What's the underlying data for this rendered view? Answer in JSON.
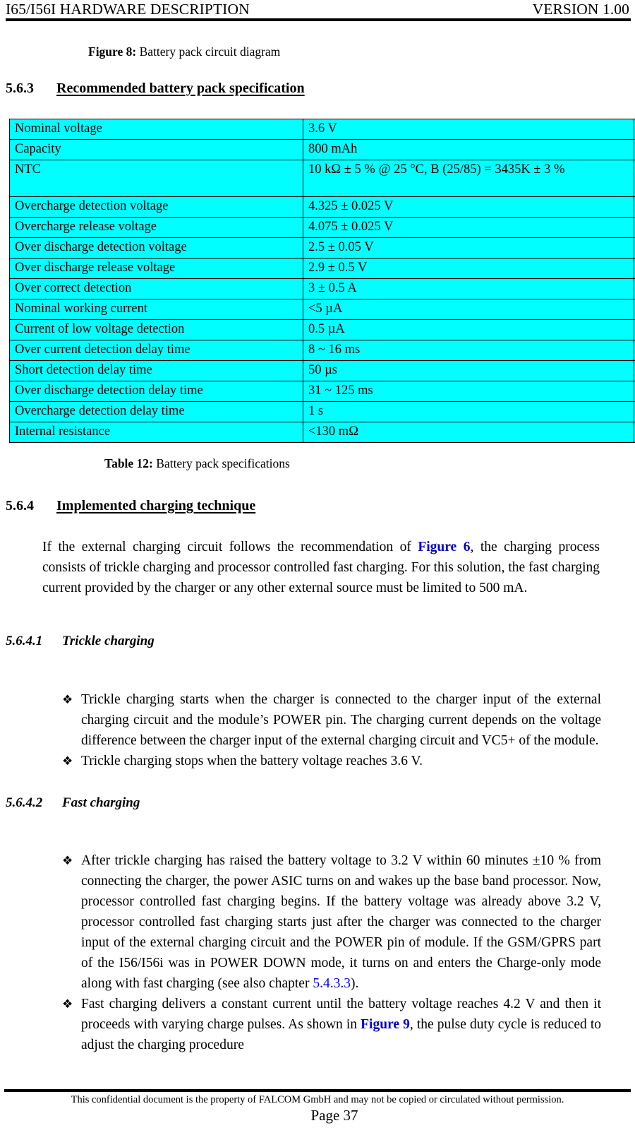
{
  "header": {
    "left": "I65/I56I HARDWARE DESCRIPTION",
    "right": "VERSION 1.00"
  },
  "figure_caption": {
    "label": "Figure 8:",
    "text": " Battery pack circuit diagram"
  },
  "section_563": {
    "number": "5.6.3",
    "title": "Recommended battery pack specification"
  },
  "spec_table": {
    "rows": [
      {
        "name": "Nominal voltage",
        "value": "3.6 V"
      },
      {
        "name": "Capacity",
        "value": "800 mAh"
      },
      {
        "name": "NTC",
        "value": "10 kΩ ± 5 % @ 25 °C, B (25/85) = 3435K ± 3 %"
      },
      {
        "name": "Overcharge detection voltage",
        "value": "4.325 ± 0.025 V"
      },
      {
        "name": "Overcharge release voltage",
        "value": "4.075 ± 0.025 V"
      },
      {
        "name": "Over discharge detection voltage",
        "value": "2.5 ± 0.05 V"
      },
      {
        "name": "Over discharge release voltage",
        "value": "2.9 ± 0.5 V"
      },
      {
        "name": "Over correct detection",
        "value": "3 ± 0.5 A"
      },
      {
        "name": "Nominal working current",
        "value": "<5 µA"
      },
      {
        "name": "Current of low voltage detection",
        "value": "0.5 µA"
      },
      {
        "name": "Over current detection delay time",
        "value": "8 ~ 16 ms"
      },
      {
        "name": "Short detection delay time",
        "value": "50 µs"
      },
      {
        "name": "Over discharge detection delay time",
        "value": "31 ~ 125 ms"
      },
      {
        "name": "Overcharge detection delay time",
        "value": "1 s"
      },
      {
        "name": "Internal resistance",
        "value": "<130 mΩ"
      }
    ]
  },
  "table_caption": {
    "label": "Table 12:",
    "text": " Battery pack specifications"
  },
  "section_564": {
    "number": "5.6.4",
    "title": "Implemented charging technique",
    "paragraph_before_xref": "If the external charging circuit follows the recommendation of ",
    "xref_figure6": "Figure 6",
    "paragraph_after_xref": ", the charging process consists of trickle charging and processor controlled fast charging. For this solution, the fast charging current provided by the charger or any other external source must be limited to 500 mA."
  },
  "section_5641": {
    "number": "5.6.4.1",
    "title": "Trickle charging",
    "bullets": [
      "Trickle charging starts when the charger is connected to the charger input of the external charging circuit and the module’s POWER pin. The charging current depends on the voltage difference between the charger input of the external charging circuit and VC5+ of the module.",
      "Trickle charging stops when the battery voltage reaches 3.6 V."
    ]
  },
  "section_5642": {
    "number": "5.6.4.2",
    "title": "Fast charging",
    "bullet1_before_xref": "After trickle charging has raised the battery voltage to 3.2 V within 60 minutes ±10 % from connecting the charger, the power ASIC turns on and wakes up the base band processor. Now, processor controlled fast charging begins. If the battery voltage was already above 3.2 V, processor controlled fast charging starts just after the charger was connected to the charger input of the external charging circuit and the POWER pin of module. If the GSM/GPRS part of the I56/I56i was in POWER DOWN mode, it turns on and enters the Charge-only mode along with fast charging (see also chapter ",
    "bullet1_xref": "5.4.3.3",
    "bullet1_after_xref": ").",
    "bullet2_before_xref": "Fast charging delivers a constant current until the battery voltage reaches 4.2 V and then it proceeds with varying charge pulses. As shown in ",
    "bullet2_xref": "Figure 9",
    "bullet2_after_xref": ", the pulse duty cycle is reduced to adjust the charging procedure"
  },
  "bullet_glyph": "❖",
  "footer": {
    "note": "This confidential document is the property of FALCOM GmbH and may not be copied or circulated without permission.",
    "page": "Page 37"
  }
}
